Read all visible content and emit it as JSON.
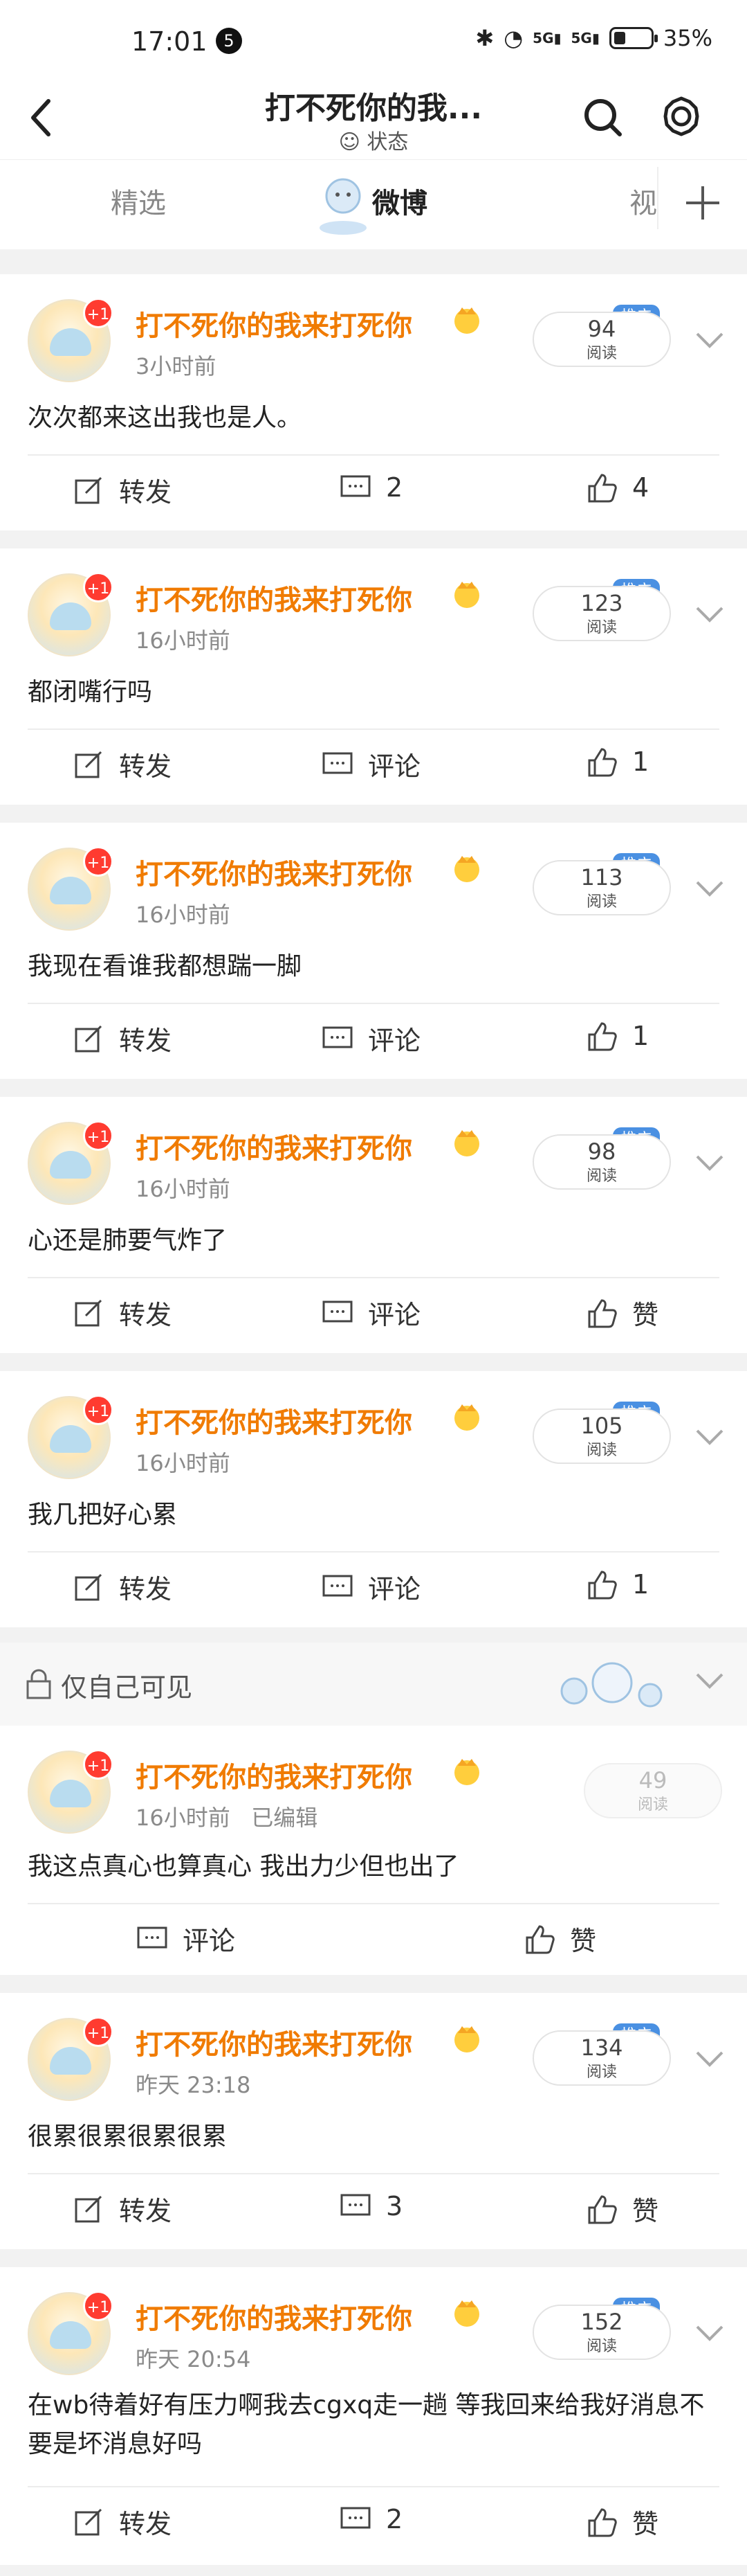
{
  "status_bar": {
    "time": "17:01",
    "notification_count": "5",
    "network_1": "5G",
    "network_2": "5G",
    "battery": "35%"
  },
  "header": {
    "title": "打不死你的我...",
    "subtitle": "状态"
  },
  "tabs": [
    {
      "label": "精选"
    },
    {
      "label": "微博"
    },
    {
      "label": "视"
    }
  ],
  "user": {
    "name": "打不死你的我来打死你",
    "avatar_badge": "+1"
  },
  "labels": {
    "read": "阅读",
    "promote": "推广",
    "repost": "转发",
    "comment": "评论",
    "like": "赞",
    "edited": "已编辑",
    "private": "仅自己可见"
  },
  "posts": [
    {
      "time": "3小时前",
      "reads": "94",
      "text": "次次都来这出我也是人。",
      "comments": "2",
      "likes": "4"
    },
    {
      "time": "16小时前",
      "reads": "123",
      "text": "都闭嘴行吗",
      "comments": "评论",
      "likes": "1"
    },
    {
      "time": "16小时前",
      "reads": "113",
      "text": "我现在看谁我都想踹一脚",
      "comments": "评论",
      "likes": "1"
    },
    {
      "time": "16小时前",
      "reads": "98",
      "text": "心还是肺要气炸了",
      "comments": "评论",
      "likes": "赞"
    },
    {
      "time": "16小时前",
      "reads": "105",
      "text": "我几把好心累",
      "comments": "评论",
      "likes": "1"
    },
    {
      "time": "16小时前",
      "reads": "49",
      "text": "我这点真心也算真心 我出力少但也出了",
      "comments": "评论",
      "likes": "赞"
    },
    {
      "time": "昨天 23:18",
      "reads": "134",
      "text": "很累很累很累很累",
      "comments": "3",
      "likes": "赞"
    },
    {
      "time": "昨天 20:54",
      "reads": "152",
      "text": "在wb待着好有压力啊我去cgxq走一趟 等我回来给我好消息不要是坏消息好吗",
      "comments": "2",
      "likes": "赞"
    }
  ],
  "colors": {
    "username": "#f07b00",
    "badge": "#ff3b30",
    "promote": "#4a90e2"
  }
}
